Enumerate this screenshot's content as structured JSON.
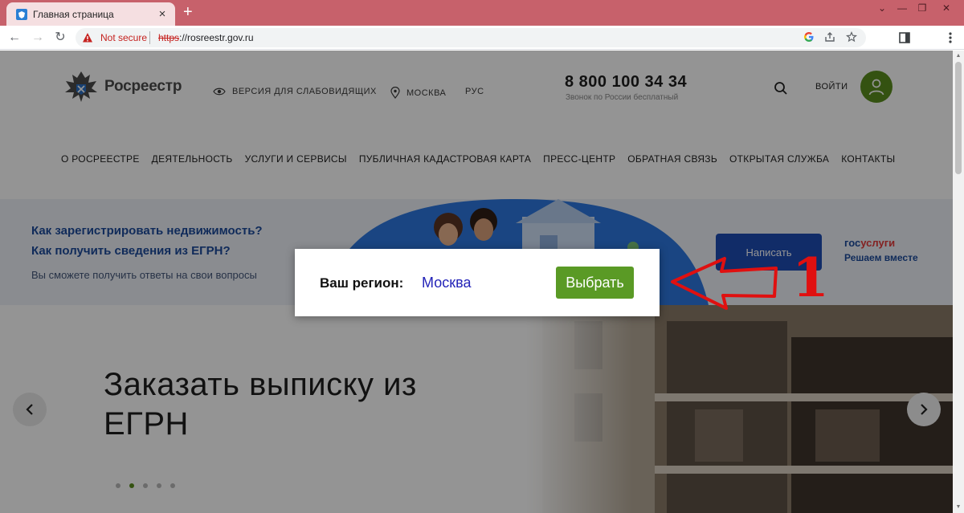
{
  "browser": {
    "tab_title": "Главная страница",
    "tab_close": "×",
    "new_tab": "+",
    "window_controls": [
      "⌄",
      "—",
      "❐",
      "✕"
    ],
    "back": "←",
    "forward": "→",
    "reload": "↻",
    "security_label": "Not secure",
    "url_scheme": "https",
    "url_rest": "://rosreestr.gov.ru",
    "omnibox_icons": [
      "google-icon",
      "share-icon",
      "star-icon"
    ],
    "toolbar_icons": [
      "side-panel-icon",
      "menu-icon"
    ]
  },
  "header": {
    "logo_text": "Росреестр",
    "accessibility_link": "ВЕРСИЯ ДЛЯ СЛАБОВИДЯЩИХ",
    "location_link": "МОСКВА",
    "language_link": "РУС",
    "phone": "8 800 100 34 34",
    "phone_note": "Звонок по России бесплатный",
    "login_link": "ВОЙТИ"
  },
  "nav": {
    "items": [
      "О РОСРЕЕСТРЕ",
      "ДЕЯТЕЛЬНОСТЬ",
      "УСЛУГИ И СЕРВИСЫ",
      "ПУБЛИЧНАЯ КАДАСТРОВАЯ КАРТА",
      "ПРЕСС-ЦЕНТР",
      "ОБРАТНАЯ СВЯЗЬ",
      "ОТКРЫТАЯ СЛУЖБА",
      "КОНТАКТЫ"
    ]
  },
  "banner": {
    "question_1": "Как зарегистрировать недвижимость?",
    "question_2": "Как получить сведения из ЕГРН?",
    "subtitle": "Вы сможете получить ответы на свои вопросы",
    "button_label": "Написать",
    "gos_prefix": "гос",
    "gos_suffix": "услуги",
    "gos_tagline": "Решаем вместе"
  },
  "hero": {
    "title": "Заказать выписку из ЕГРН",
    "dots_count": 5,
    "active_dot": 2
  },
  "modal": {
    "label": "Ваш регион:",
    "region": "Москва",
    "button_label": "Выбрать"
  },
  "annotation": {
    "number": "1",
    "color": "#e01010"
  },
  "colors": {
    "tab_strip": "#c7616b",
    "brand_green": "#5a9a25",
    "brand_blue": "#1c4a9c"
  }
}
